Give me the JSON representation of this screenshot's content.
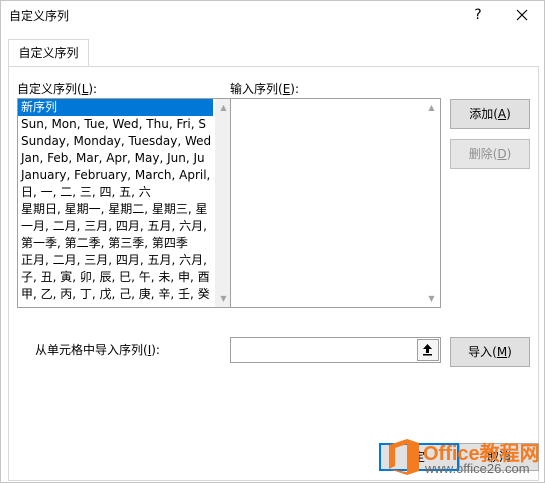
{
  "window": {
    "title": "自定义序列",
    "help_glyph": "?"
  },
  "tabs": [
    {
      "label": "自定义序列"
    }
  ],
  "custom_lists": {
    "label_text": "自定义序列(",
    "label_accel": "L",
    "label_suffix": "):",
    "items": [
      "新序列",
      "Sun, Mon, Tue, Wed, Thu, Fri, S",
      "Sunday, Monday, Tuesday, Wed",
      "Jan, Feb, Mar, Apr, May, Jun, Ju",
      "January, February, March, April,",
      "日, 一, 二, 三, 四, 五, 六",
      "星期日, 星期一, 星期二, 星期三, 星",
      "一月, 二月, 三月, 四月, 五月, 六月,",
      "第一季, 第二季, 第三季, 第四季",
      "正月, 二月, 三月, 四月, 五月, 六月,",
      "子, 丑, 寅, 卯, 辰, 巳, 午, 未, 申, 酉",
      "甲, 乙, 丙, 丁, 戊, 己, 庚, 辛, 壬, 癸"
    ],
    "selected_index": 0
  },
  "entries": {
    "label_text": "输入序列(",
    "label_accel": "E",
    "label_suffix": "):",
    "value": ""
  },
  "buttons": {
    "add": {
      "text": "添加(",
      "accel": "A",
      "suffix": ")"
    },
    "delete": {
      "text": "删除(",
      "accel": "D",
      "suffix": ")"
    },
    "import": {
      "text": "导入(",
      "accel": "M",
      "suffix": ")"
    }
  },
  "import_section": {
    "label_text": "从单元格中导入序列(",
    "label_accel": "I",
    "label_suffix": "):",
    "value": ""
  },
  "footer": {
    "ok_partial": "定",
    "cancel_partial": "取消"
  },
  "watermark": {
    "title": "Office教程网",
    "url": "www.office26.com"
  },
  "colors": {
    "selection": "#0078d7",
    "watermark_orange": "#f47b20",
    "default_button_border": "#0078d7"
  }
}
